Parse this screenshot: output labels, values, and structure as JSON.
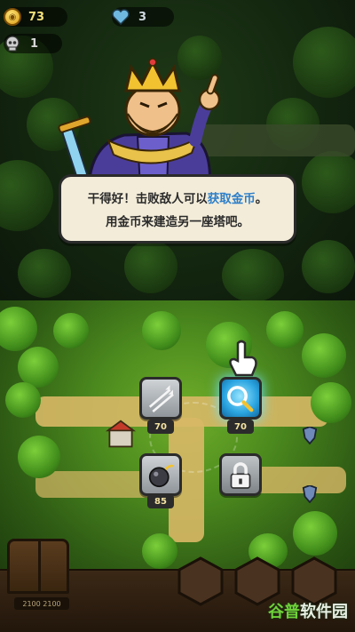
{
  "hud": {
    "gold": "73",
    "lives": "3",
    "kills": "1"
  },
  "icons": {
    "gold": "coin-icon",
    "lives": "heart-icon",
    "kills": "skull-icon",
    "arrow_tower": "arrows-icon",
    "mage_tower": "magnifier-icon",
    "bomb_tower": "bomb-icon",
    "locked": "lock-icon",
    "hand": "pointing-hand-icon"
  },
  "dialog": {
    "line1_prefix": "干得好！击败敌人可以",
    "line1_highlight": "获取金币",
    "line1_suffix": "。",
    "line2": "用金币来建造另一座塔吧。"
  },
  "build_menu": {
    "arrow_price": "70",
    "mage_price": "70",
    "bomb_price": "85"
  },
  "bottom": {
    "wave_label": "2100 2100"
  },
  "watermark": {
    "part1": "谷普",
    "part2": "软件园"
  },
  "colors": {
    "highlight_text": "#2d7fc9",
    "gold_text": "#f2e07a",
    "bubble_bg": "#f3ecd9"
  }
}
